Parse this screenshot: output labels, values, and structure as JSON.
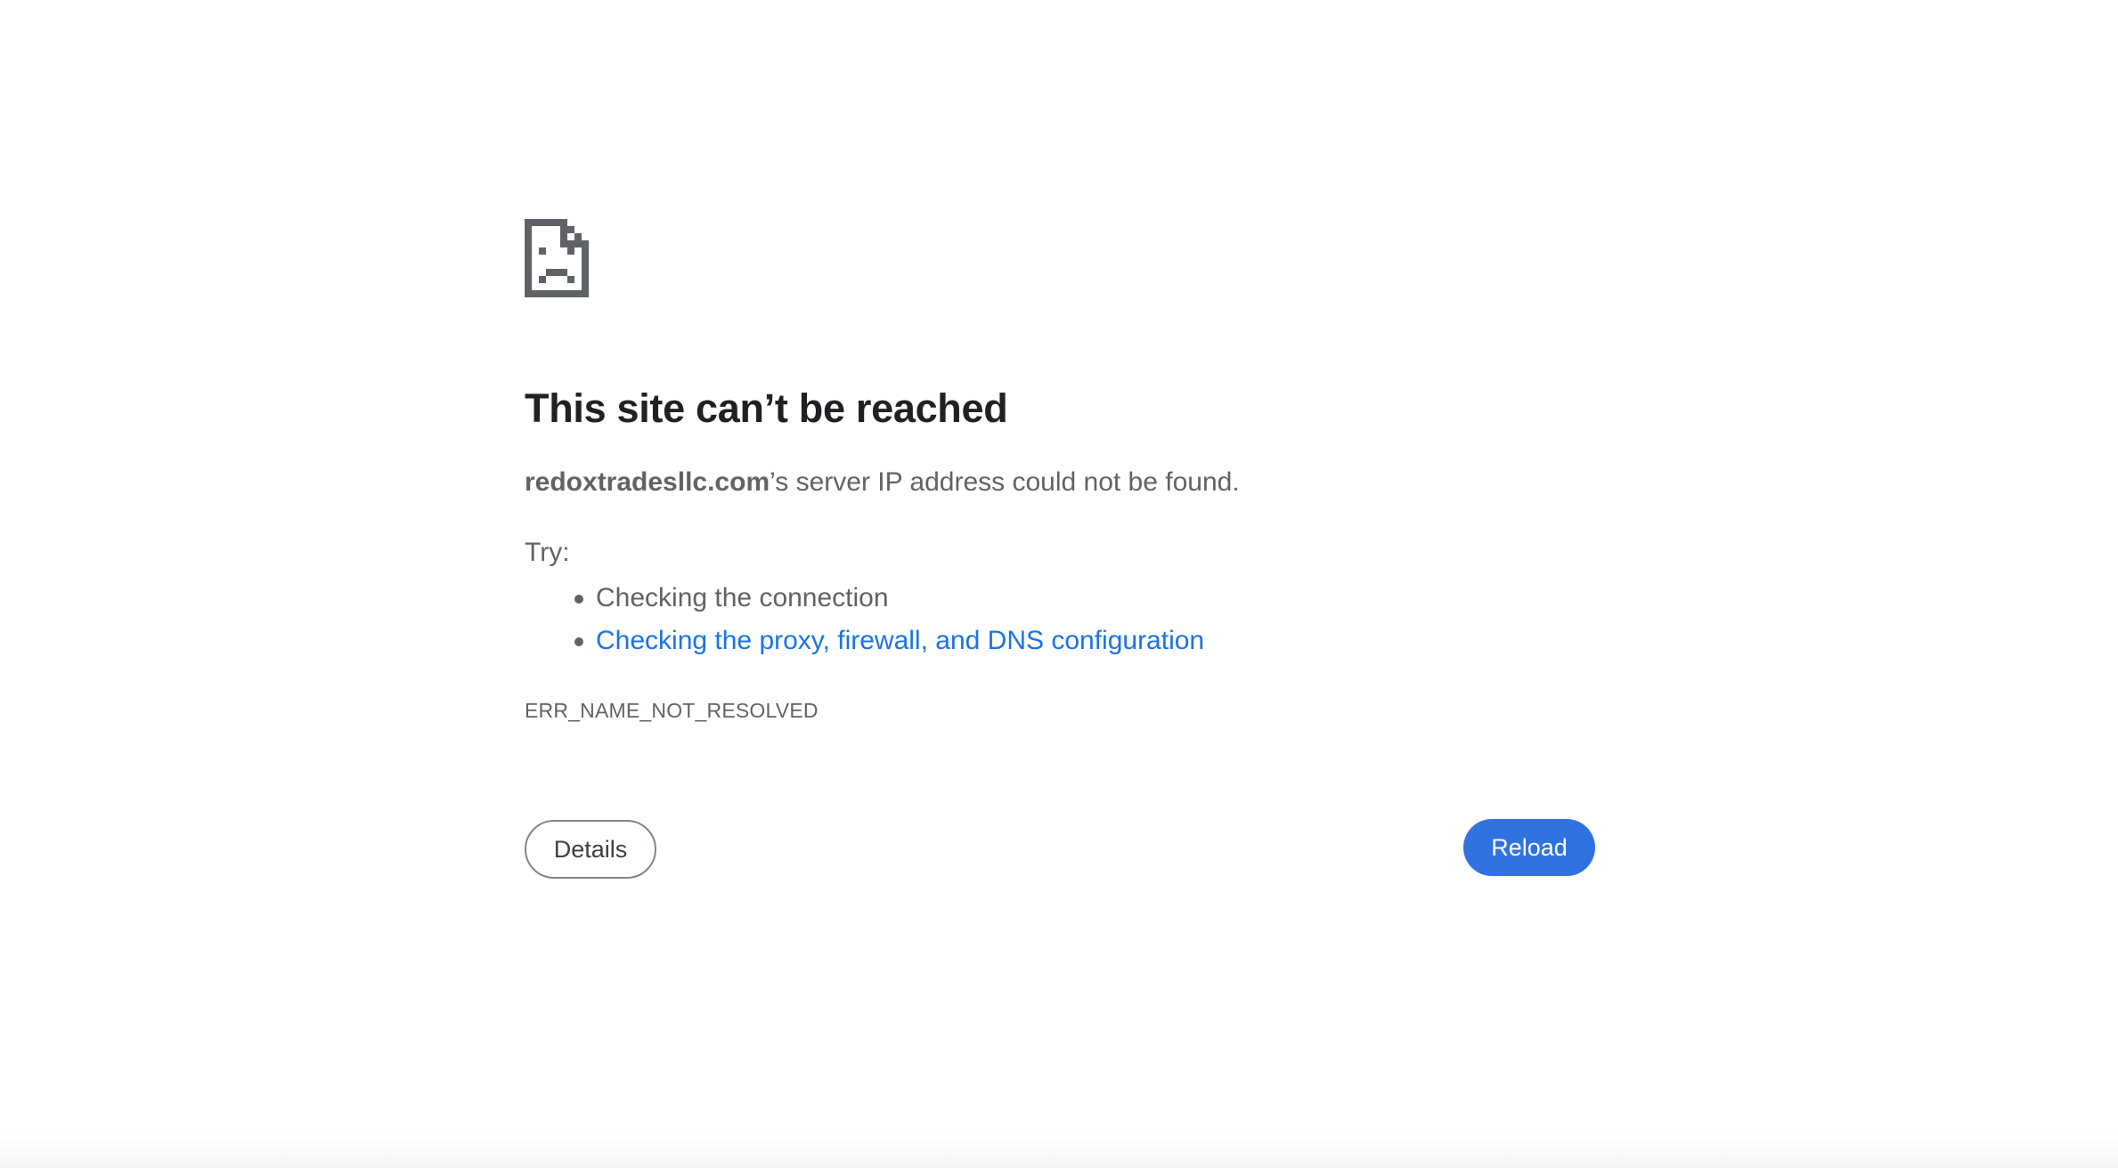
{
  "error_page": {
    "icon": "sad-document-icon",
    "title": "This site can’t be reached",
    "summary": {
      "host": "redoxtradesllc.com",
      "message": "’s server IP address could not be found."
    },
    "try_label": "Try:",
    "suggestions": [
      {
        "text": "Checking the connection",
        "is_link": false
      },
      {
        "text": "Checking the proxy, firewall, and DNS configuration",
        "is_link": true
      }
    ],
    "error_code": "ERR_NAME_NOT_RESOLVED"
  },
  "buttons": {
    "details_label": "Details",
    "reload_label": "Reload"
  },
  "colors": {
    "title": "#202124",
    "body_text": "#5f6368",
    "link": "#1a73e8",
    "reload_bg": "#3072e0"
  }
}
